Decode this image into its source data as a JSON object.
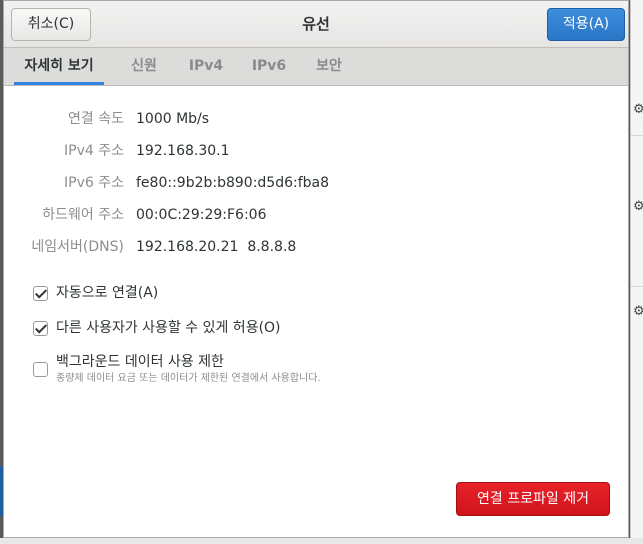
{
  "dialog": {
    "title": "유선",
    "cancel_label": "취소(C)",
    "apply_label": "적용(A)"
  },
  "tabs": [
    {
      "label": "자세히 보기",
      "active": true
    },
    {
      "label": "신원",
      "active": false
    },
    {
      "label": "IPv4",
      "active": false
    },
    {
      "label": "IPv6",
      "active": false
    },
    {
      "label": "보안",
      "active": false
    }
  ],
  "details": [
    {
      "label": "연결 속도",
      "value": "1000 Mb/s"
    },
    {
      "label": "IPv4 주소",
      "value": "192.168.30.1"
    },
    {
      "label": "IPv6 주소",
      "value": "fe80::9b2b:b890:d5d6:fba8"
    },
    {
      "label": "하드웨어 주소",
      "value": "00:0C:29:29:F6:06"
    },
    {
      "label": "네임서버(DNS)",
      "value": "192.168.20.21  8.8.8.8"
    }
  ],
  "options": [
    {
      "label": "자동으로 연결(A)",
      "checked": true,
      "sub": ""
    },
    {
      "label": "다른 사용자가 사용할 수 있게 허용(O)",
      "checked": true,
      "sub": ""
    },
    {
      "label": "백그라운드 데이터 사용 제한",
      "checked": false,
      "sub": "종량제 데이터 요금 또는 데이터가 제한된 연결에서 사용합니다."
    }
  ],
  "remove_label": "연결 프로파일 제거",
  "colors": {
    "accent": "#3584e4",
    "apply_button": "#2a76c6",
    "destructive_button": "#d0141b"
  }
}
